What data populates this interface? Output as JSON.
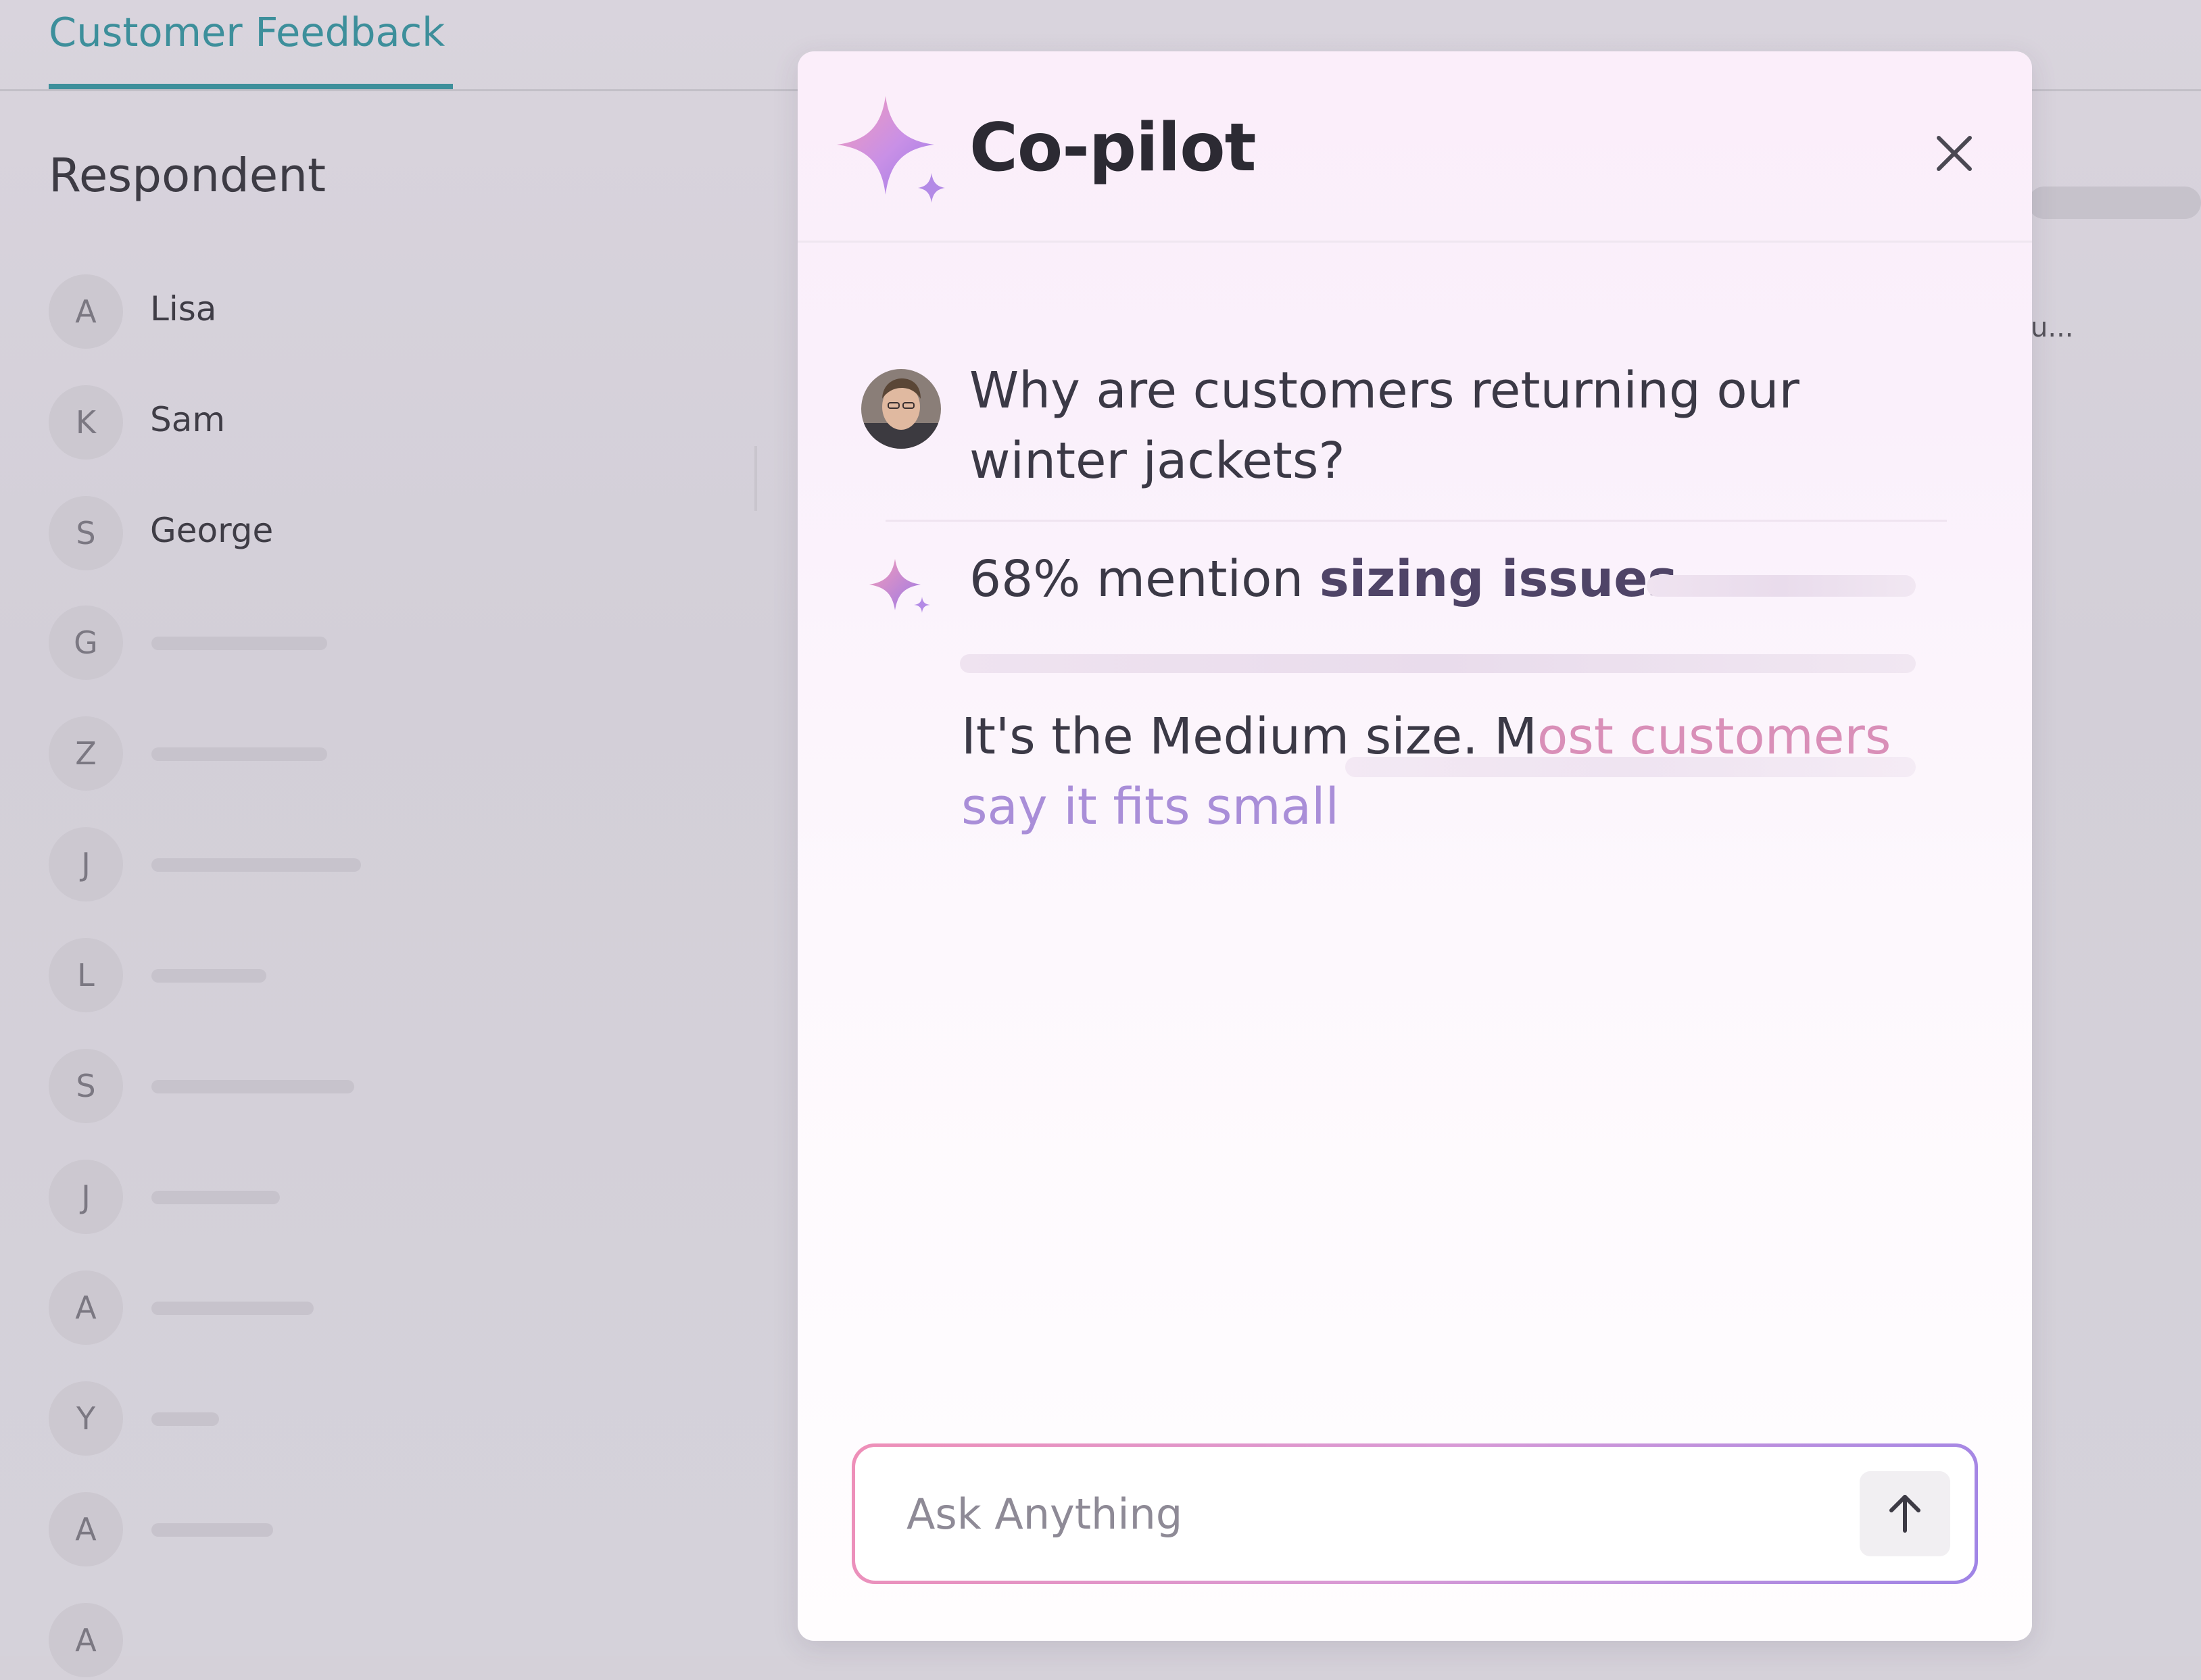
{
  "background": {
    "tab_label": "Customer Feedback",
    "column_header": "Respondent",
    "respondents": [
      {
        "initial": "A",
        "name": "Lisa"
      },
      {
        "initial": "K",
        "name": "Sam"
      },
      {
        "initial": "S",
        "name": "George"
      },
      {
        "initial": "G",
        "name": ""
      },
      {
        "initial": "Z",
        "name": ""
      },
      {
        "initial": "J",
        "name": ""
      },
      {
        "initial": "L",
        "name": ""
      },
      {
        "initial": "S",
        "name": ""
      },
      {
        "initial": "J",
        "name": ""
      },
      {
        "initial": "A",
        "name": ""
      },
      {
        "initial": "Y",
        "name": ""
      },
      {
        "initial": "A",
        "name": ""
      },
      {
        "initial": "A",
        "name": ""
      }
    ],
    "right_snippet": "u..."
  },
  "copilot": {
    "title": "Co-pilot",
    "close_icon": "close-icon",
    "logo_icon": "sparkle-icon",
    "user_question": "Why are customers returning our winter jackets?",
    "answer": {
      "headline_prefix": "68% mention",
      "headline_bold": "sizing issues",
      "body_plain": "It's the Medium size. M",
      "body_fade_1": "ost customers",
      "body_fade_2": "say it fits small"
    },
    "input": {
      "placeholder": "Ask Anything",
      "value": ""
    },
    "send_icon": "arrow-up-icon",
    "colors": {
      "accent_teal": "#3d8f9b",
      "gradient_pink": "#ee8fb8",
      "gradient_purple": "#9f84e6"
    }
  }
}
